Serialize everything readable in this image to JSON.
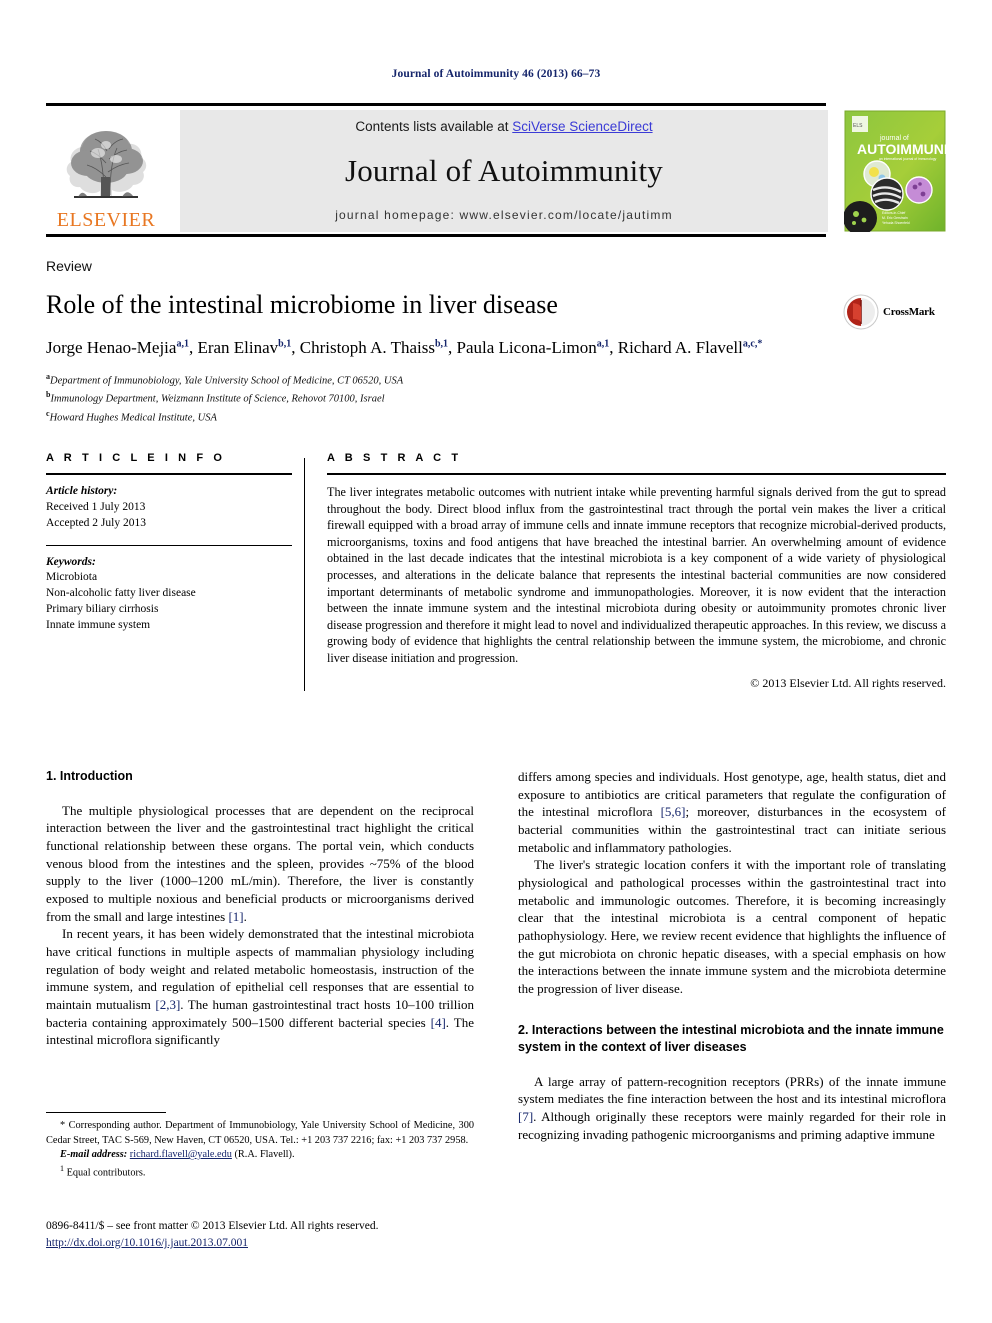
{
  "running_head": "Journal of Autoimmunity 46 (2013) 66–73",
  "masthead": {
    "contents_prefix": "Contents lists available at ",
    "contents_link": "SciVerse ScienceDirect",
    "journal_name": "Journal of Autoimmunity",
    "homepage": "journal homepage: www.elsevier.com/locate/jautimm",
    "publisher_wordmark": "ELSEVIER",
    "publisher_color": "#E87722",
    "link_color": "#3b3bd6",
    "banner_bg": "#e8e8e8",
    "cover": {
      "line1": "journal of",
      "line2": "AUTOIMMUNITY",
      "tagline": "an international journal of immunology"
    }
  },
  "title_block": {
    "doctype": "Review",
    "title": "Role of the intestinal microbiome in liver disease",
    "authors_html": "Jorge Henao-Mejia<sup>a,1</sup>, Eran Elinav<sup>b,1</sup>, Christoph A. Thaiss<sup>b,1</sup>, Paula Licona-Limon<sup>a,1</sup>, Richard A. Flavell<sup>a,c,</sup><sup>*</sup>",
    "affiliations": [
      {
        "marker": "a",
        "text": "Department of Immunobiology, Yale University School of Medicine, CT 06520, USA"
      },
      {
        "marker": "b",
        "text": "Immunology Department, Weizmann Institute of Science, Rehovot 70100, Israel"
      },
      {
        "marker": "c",
        "text": "Howard Hughes Medical Institute, USA"
      }
    ],
    "crossmark_label": "CrossMark"
  },
  "article_info": {
    "heading": "A R T I C L E   I N F O",
    "history_label": "Article history:",
    "history": [
      "Received 1 July 2013",
      "Accepted 2 July 2013"
    ],
    "keywords_label": "Keywords:",
    "keywords": [
      "Microbiota",
      "Non-alcoholic fatty liver disease",
      "Primary biliary cirrhosis",
      "Innate immune system"
    ]
  },
  "abstract": {
    "heading": "A B S T R A C T",
    "text": "The liver integrates metabolic outcomes with nutrient intake while preventing harmful signals derived from the gut to spread throughout the body. Direct blood influx from the gastrointestinal tract through the portal vein makes the liver a critical firewall equipped with a broad array of immune cells and innate immune receptors that recognize microbial-derived products, microorganisms, toxins and food antigens that have breached the intestinal barrier. An overwhelming amount of evidence obtained in the last decade indicates that the intestinal microbiota is a key component of a wide variety of physiological processes, and alterations in the delicate balance that represents the intestinal bacterial communities are now considered important determinants of metabolic syndrome and immunopathologies. Moreover, it is now evident that the interaction between the innate immune system and the intestinal microbiota during obesity or autoimmunity promotes chronic liver disease progression and therefore it might lead to novel and individualized therapeutic approaches. In this review, we discuss a growing body of evidence that highlights the central relationship between the immune system, the microbiome, and chronic liver disease initiation and progression.",
    "copyright": "© 2013 Elsevier Ltd. All rights reserved."
  },
  "body": {
    "left": {
      "section_heading": "1. Introduction",
      "paragraph_1_a": "The multiple physiological processes that are dependent on the reciprocal interaction between the liver and the gastrointestinal tract highlight the critical functional relationship between these organs. The portal vein, which conducts venous blood from the intestines and the spleen, provides ~75% of the blood supply to the liver (1000–1200 mL/min). Therefore, the liver is constantly exposed to multiple noxious and beneficial products or microorganisms derived from the small and large intestines ",
      "paragraph_1_ref": "[1]",
      "paragraph_1_b": ".",
      "paragraph_2_a": "In recent years, it has been widely demonstrated that the intestinal microbiota have critical functions in multiple aspects of mammalian physiology including regulation of body weight and related metabolic homeostasis, instruction of the immune system, and regulation of epithelial cell responses that are essential to maintain mutualism ",
      "paragraph_2_ref1": "[2,3]",
      "paragraph_2_b": ". The human gastrointestinal tract hosts 10–100 trillion bacteria containing approximately 500–1500 different bacterial species ",
      "paragraph_2_ref2": "[4]",
      "paragraph_2_c": ". The intestinal microflora significantly"
    },
    "right": {
      "paragraph_1_a": "differs among species and individuals. Host genotype, age, health status, diet and exposure to antibiotics are critical parameters that regulate the configuration of the intestinal microflora ",
      "paragraph_1_ref": "[5,6]",
      "paragraph_1_b": "; moreover, disturbances in the ecosystem of bacterial communities within the gastrointestinal tract can initiate serious metabolic and inflammatory pathologies.",
      "paragraph_2": "The liver's strategic location confers it with the important role of translating physiological and pathological processes within the gastrointestinal tract into metabolic and immunologic outcomes. Therefore, it is becoming increasingly clear that the intestinal microbiota is a central component of hepatic pathophysiology. Here, we review recent evidence that highlights the influence of the gut microbiota on chronic hepatic diseases, with a special emphasis on how the interactions between the innate immune system and the microbiota determine the progression of liver disease.",
      "section_heading": "2. Interactions between the intestinal microbiota and the innate immune system in the context of liver diseases",
      "paragraph_3_a": "A large array of pattern-recognition receptors (PRRs) of the innate immune system mediates the fine interaction between the host and its intestinal microflora ",
      "paragraph_3_ref": "[7]",
      "paragraph_3_b": ". Although originally these receptors were mainly regarded for their role in recognizing invading pathogenic microorganisms and priming adaptive immune"
    }
  },
  "footnotes": {
    "corresponding_marker": "*",
    "corresponding": "Corresponding author. Department of Immunobiology, Yale University School of Medicine, 300 Cedar Street, TAC S-569, New Haven, CT 06520, USA. Tel.: +1 203 737 2216; fax: +1 203 737 2958.",
    "email_label": "E-mail address:",
    "email": "richard.flavell@yale.edu",
    "email_suffix": "(R.A. Flavell).",
    "equal_marker": "1",
    "equal_text": "Equal contributors."
  },
  "colophon": {
    "issn_line": "0896-8411/$ – see front matter © 2013 Elsevier Ltd. All rights reserved.",
    "doi": "http://dx.doi.org/10.1016/j.jaut.2013.07.001"
  }
}
